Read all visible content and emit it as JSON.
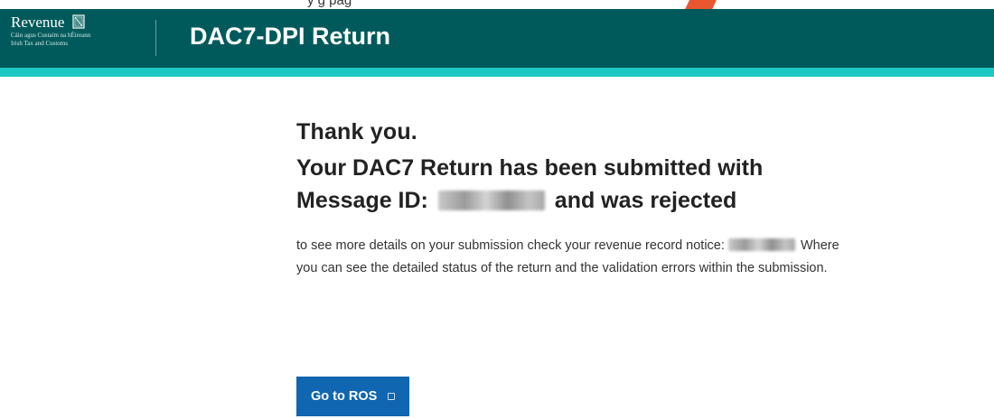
{
  "header": {
    "brand": "Revenue",
    "brand_sub_line1": "Cáin agus Custaim na hÉireann",
    "brand_sub_line2": "Irish Tax and Customs",
    "app_title": "DAC7-DPI Return",
    "top_cut_text": "y                                                     g      pag"
  },
  "main": {
    "thanks": "Thank you.",
    "status_part1": "Your DAC7 Return has been submitted with Message ID: ",
    "status_part2": " and was rejected",
    "detail_part1": "to see more details on your submission check your revenue record notice: ",
    "detail_part2": " Where you can see the detailed status of the return and the validation errors within the submission.",
    "button_label": "Go to ROS"
  },
  "colors": {
    "header_bg": "#005a5b",
    "stripe": "#1ec7c4",
    "button_bg": "#1066b0"
  },
  "icons": {
    "logo": "harp-icon",
    "button": "external-link-icon"
  }
}
